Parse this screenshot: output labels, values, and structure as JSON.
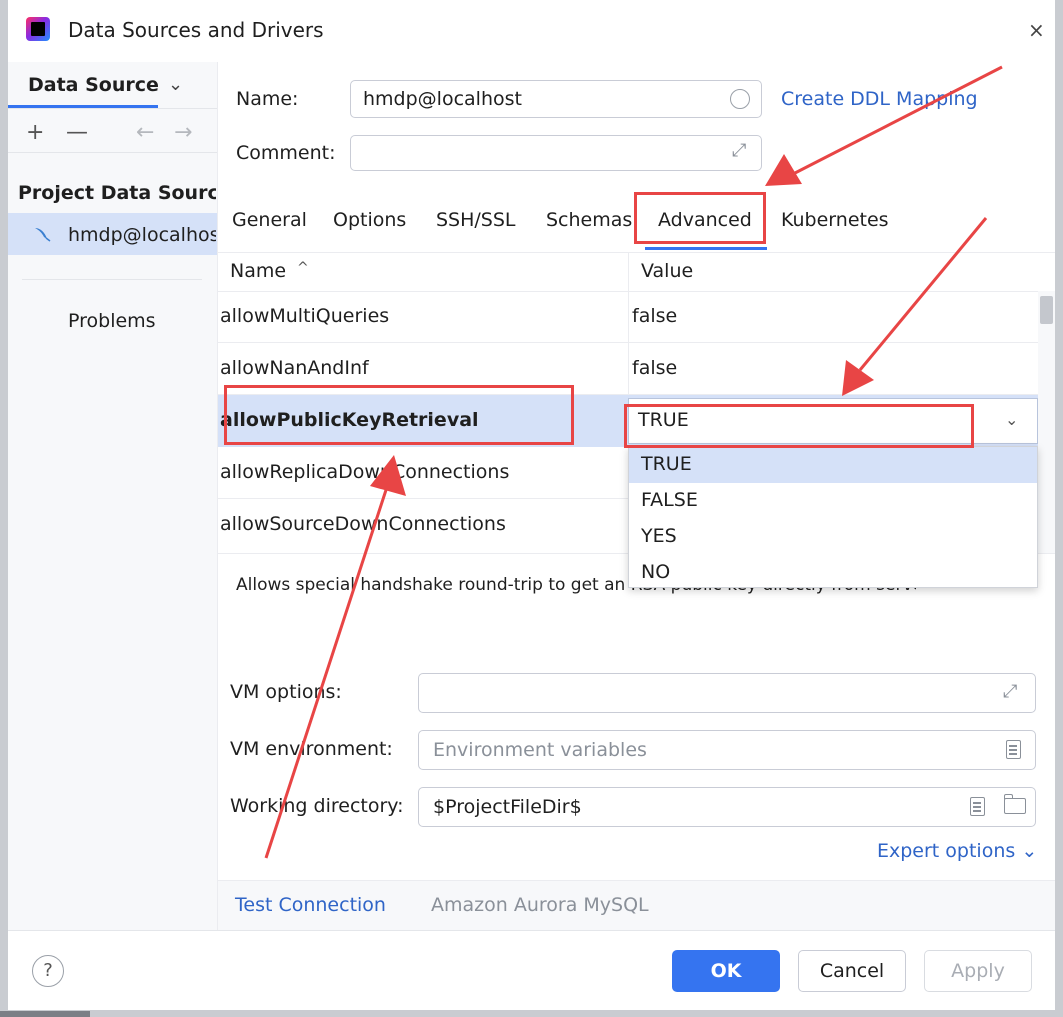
{
  "window": {
    "title": "Data Sources and Drivers",
    "close_glyph": "×"
  },
  "sidebar": {
    "tab_label": "Data Sources",
    "tab_chevron": "⌄",
    "toolbar": {
      "add": "+",
      "remove": "—",
      "back": "←",
      "forward": "→"
    },
    "group_label": "Project Data Sources",
    "items": [
      {
        "label": "hmdp@localhost",
        "icon": "mysql-dolphin-icon"
      }
    ],
    "problems_label": "Problems"
  },
  "form": {
    "name_label": "Name:",
    "name_value": "hmdp@localhost",
    "ddl_link": "Create DDL Mapping",
    "comment_label": "Comment:",
    "comment_value": ""
  },
  "tabs": [
    {
      "label": "General"
    },
    {
      "label": "Options"
    },
    {
      "label": "SSH/SSL"
    },
    {
      "label": "Schemas"
    },
    {
      "label": "Advanced",
      "active": true
    },
    {
      "label": "Kubernetes"
    }
  ],
  "table": {
    "columns": {
      "name": "Name",
      "value": "Value"
    },
    "sort_glyph": "^",
    "rows": [
      {
        "name": "allowMultiQueries",
        "value": "false"
      },
      {
        "name": "allowNanAndInf",
        "value": "false"
      },
      {
        "name": "allowPublicKeyRetrieval",
        "value": "TRUE",
        "selected": true
      },
      {
        "name": "allowReplicaDownConnections",
        "value": ""
      },
      {
        "name": "allowSourceDownConnections",
        "value": ""
      }
    ],
    "dropdown": {
      "chevron": "⌄",
      "options": [
        "TRUE",
        "FALSE",
        "YES",
        "NO"
      ],
      "highlighted": "TRUE"
    },
    "description": "Allows special handshake round-trip to get an RSA public key directly from server."
  },
  "vm": {
    "options_label": "VM options:",
    "options_value": "",
    "environment_label": "VM environment:",
    "environment_placeholder": "Environment variables",
    "workdir_label": "Working directory:",
    "workdir_value": "$ProjectFileDir$",
    "expert_options": "Expert options ⌄"
  },
  "bottom": {
    "test_connection": "Test Connection",
    "driver": "Amazon Aurora MySQL"
  },
  "footer": {
    "help": "?",
    "ok": "OK",
    "cancel": "Cancel",
    "apply": "Apply"
  },
  "colors": {
    "accent": "#3574f0",
    "link": "#2f64c7",
    "selection": "#d5e1f8",
    "annotation_red": "#e84545"
  }
}
